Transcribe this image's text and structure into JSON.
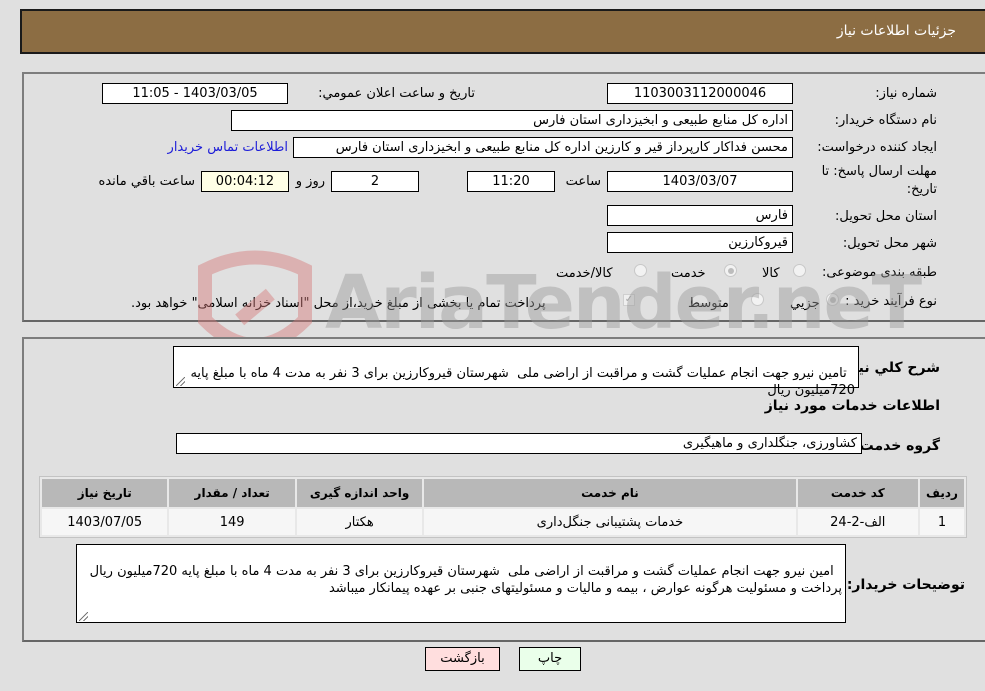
{
  "header": {
    "title": "جزئیات اطلاعات نیاز"
  },
  "form": {
    "need_number": {
      "label": "شماره نیاز:",
      "value": "1103003112000046"
    },
    "announce_datetime": {
      "label": "تاریخ و ساعت اعلان عمومي:",
      "value": "1403/03/05 - 11:05"
    },
    "buyer_org": {
      "label": "نام دستگاه خریدار:",
      "value": "اداره کل منابع طبیعی و ابخیزداری استان فارس"
    },
    "requester": {
      "label": "ایجاد کننده درخواست:",
      "value": "محسن فداکار کارپرداز قیر و کارزین اداره کل منابع طبیعی و ابخیزداری استان فارس",
      "contact_link": "اطلاعات تماس خریدار"
    },
    "deadline": {
      "label_line1": "مهلت ارسال پاسخ: تا",
      "label_line2": "تاریخ:",
      "date": "1403/03/07",
      "time_label": "ساعت",
      "time": "11:20",
      "days": "2",
      "days_label": "روز و",
      "remaining": "00:04:12",
      "remaining_label": "ساعت باقي مانده"
    },
    "province": {
      "label": "استان محل تحویل:",
      "value": "فارس"
    },
    "city": {
      "label": "شهر محل تحویل:",
      "value": "قیروکارزین"
    },
    "category": {
      "label": "طبقه بندی موضوعی:",
      "options": [
        "کالا",
        "خدمت",
        "کالا/خدمت"
      ],
      "selected": "خدمت"
    },
    "purchase_type": {
      "label": "نوع فرآیند خرید :",
      "options": [
        "جزیي",
        "متوسط"
      ],
      "selected": "جزیي",
      "treasury_note": "پرداخت تمام یا بخشی از مبلغ خرید،از محل \"اسناد خزانه اسلامی\" خواهد بود.",
      "treasury_checked": true
    }
  },
  "description": {
    "label": "شرح کلي نیاز:",
    "value": "تامین نیرو جهت انجام عملیات گشت و مراقبت از اراضی ملی  شهرستان قیروکارزین برای 3 نفر به مدت 4 ماه با مبلغ پایه 720میلیون ریال"
  },
  "services_section_title": "اطلاعات خدمات مورد نیاز",
  "service_group": {
    "label": "گروه خدمت:",
    "value": "کشاورزی، جنگلداری و ماهیگیری"
  },
  "table": {
    "headers": [
      "ردیف",
      "کد خدمت",
      "نام خدمت",
      "واحد اندازه گیری",
      "تعداد / مقدار",
      "تاریخ نیاز"
    ],
    "rows": [
      [
        "1",
        "الف-2-24",
        "خدمات پشتیبانی جنگل‌داری",
        "هکتار",
        "149",
        "1403/07/05"
      ]
    ]
  },
  "buyer_notes": {
    "label": "توضیحات خریدار:",
    "value": "امین نیرو جهت انجام عملیات گشت و مراقبت از اراضی ملی  شهرستان قیروکارزین برای 3 نفر به مدت 4 ماه با مبلغ پایه 720میلیون ریال\nپرداخت و مسئولیت هرگونه عوارض ، بیمه و مالیات و مسئولیتهای جنبی بر عهده پیمانکار میباشد"
  },
  "buttons": {
    "print": "چاپ",
    "back": "بازگشت"
  },
  "watermark": "AriaTender.neT",
  "colors": {
    "header_bg": "#8c6d43",
    "print_bg": "#eaffea",
    "back_bg": "#ffdede",
    "link": "#1d1dd8"
  }
}
